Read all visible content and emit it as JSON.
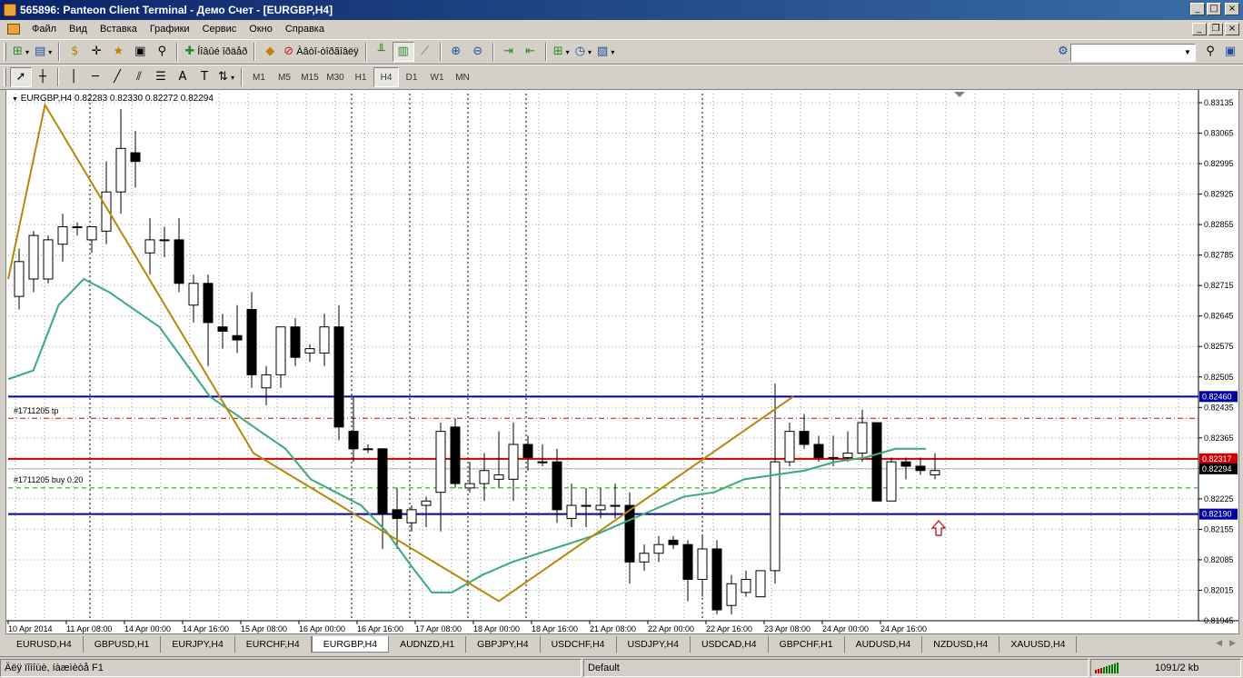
{
  "window": {
    "title": "565896: Panteon Client Terminal - Демо Счет - [EURGBP,H4]"
  },
  "menu": [
    "Файл",
    "Вид",
    "Вставка",
    "Графики",
    "Сервис",
    "Окно",
    "Справка"
  ],
  "toolbar1": {
    "new_order_label": "Íîâûé îðäåð",
    "experts_label": "Àâòî-òîðãîâëÿ"
  },
  "toolbar2": {
    "timeframes": [
      "M1",
      "M5",
      "M15",
      "M30",
      "H1",
      "H4",
      "D1",
      "W1",
      "MN"
    ],
    "active_timeframe": "H4"
  },
  "chart": {
    "symbol_info": "EURGBP,H4  0.82283 0.82330 0.82272 0.82294",
    "tp_label": "#1711205 tp",
    "buy_label": "#1711205 buy 0.20",
    "price_ticks": [
      "0.83135",
      "0.83065",
      "0.82995",
      "0.82925",
      "0.82855",
      "0.82785",
      "0.82715",
      "0.82645",
      "0.82575",
      "0.82505",
      "0.82435",
      "0.82365",
      "0.82295",
      "0.82225",
      "0.82155",
      "0.82085",
      "0.82015",
      "0.81945"
    ],
    "highlighted_prices": [
      {
        "price": "0.82460",
        "color": "#0000a0"
      },
      {
        "price": "0.82317",
        "color": "#d00000"
      },
      {
        "price": "0.82294",
        "color": "#000000"
      },
      {
        "price": "0.82190",
        "color": "#0000a0"
      }
    ],
    "time_ticks": [
      "10 Apr 2014",
      "11 Apr 08:00",
      "14 Apr 00:00",
      "14 Apr 16:00",
      "15 Apr 08:00",
      "16 Apr 00:00",
      "16 Apr 16:00",
      "17 Apr 08:00",
      "18 Apr 00:00",
      "18 Apr 16:00",
      "21 Apr 08:00",
      "22 Apr 00:00",
      "22 Apr 16:00",
      "23 Apr 08:00",
      "24 Apr 00:00",
      "24 Apr 16:00"
    ],
    "colors": {
      "grid": "#9a9a9a",
      "hline_blue": "#0000a0",
      "hline_red": "#d00000",
      "ma": "#3aaa7a",
      "zigzag": "#b8860b",
      "arrow": "#c00000",
      "tp_line": "#d00000",
      "buy_line": "#00a000"
    }
  },
  "chart_data": {
    "type": "candlestick",
    "symbol": "EURGBP",
    "timeframe": "H4",
    "ohlc": [
      [
        0.8269,
        0.828,
        0.8266,
        0.8277
      ],
      [
        0.8273,
        0.8284,
        0.827,
        0.8283
      ],
      [
        0.8273,
        0.8283,
        0.8272,
        0.8282
      ],
      [
        0.8281,
        0.8288,
        0.8277,
        0.8285
      ],
      [
        0.8285,
        0.8286,
        0.8283,
        0.8285
      ],
      [
        0.8282,
        0.8283,
        0.8279,
        0.8285
      ],
      [
        0.8284,
        0.83,
        0.8281,
        0.8293
      ],
      [
        0.8293,
        0.8312,
        0.8288,
        0.8303
      ],
      [
        0.8302,
        0.8307,
        0.8294,
        0.83
      ],
      [
        0.8279,
        0.8287,
        0.8274,
        0.8282
      ],
      [
        0.8282,
        0.8285,
        0.8278,
        0.8282
      ],
      [
        0.8282,
        0.8287,
        0.827,
        0.8272
      ],
      [
        0.8267,
        0.8274,
        0.8263,
        0.8272
      ],
      [
        0.8272,
        0.8274,
        0.8253,
        0.8263
      ],
      [
        0.8262,
        0.8265,
        0.8257,
        0.8261
      ],
      [
        0.826,
        0.8267,
        0.8256,
        0.8259
      ],
      [
        0.8266,
        0.827,
        0.8248,
        0.8251
      ],
      [
        0.8248,
        0.8253,
        0.8244,
        0.8251
      ],
      [
        0.8251,
        0.8262,
        0.8248,
        0.8262
      ],
      [
        0.8262,
        0.8264,
        0.8253,
        0.8255
      ],
      [
        0.8256,
        0.8258,
        0.8254,
        0.8257
      ],
      [
        0.8256,
        0.8265,
        0.8253,
        0.8262
      ],
      [
        0.8262,
        0.8267,
        0.8236,
        0.8239
      ],
      [
        0.8238,
        0.8246,
        0.8231,
        0.8234
      ],
      [
        0.8234,
        0.8235,
        0.8233,
        0.8234
      ],
      [
        0.8234,
        0.8234,
        0.8211,
        0.8219
      ],
      [
        0.822,
        0.8225,
        0.8211,
        0.8218
      ],
      [
        0.8217,
        0.8221,
        0.8215,
        0.822
      ],
      [
        0.8221,
        0.8223,
        0.8216,
        0.8222
      ],
      [
        0.8224,
        0.824,
        0.8215,
        0.8238
      ],
      [
        0.8239,
        0.8241,
        0.8225,
        0.8226
      ],
      [
        0.8225,
        0.8231,
        0.8224,
        0.8226
      ],
      [
        0.8226,
        0.8233,
        0.8222,
        0.8229
      ],
      [
        0.8227,
        0.8238,
        0.8225,
        0.8228
      ],
      [
        0.8227,
        0.824,
        0.8222,
        0.8235
      ],
      [
        0.8235,
        0.8237,
        0.8229,
        0.8232
      ],
      [
        0.8231,
        0.8235,
        0.823,
        0.8231
      ],
      [
        0.8231,
        0.8234,
        0.8217,
        0.822
      ],
      [
        0.8218,
        0.8226,
        0.8216,
        0.8221
      ],
      [
        0.8221,
        0.8225,
        0.8216,
        0.8221
      ],
      [
        0.822,
        0.8225,
        0.8218,
        0.8221
      ],
      [
        0.8221,
        0.8226,
        0.8218,
        0.8221
      ],
      [
        0.8221,
        0.8224,
        0.8203,
        0.8208
      ],
      [
        0.8208,
        0.8212,
        0.8206,
        0.821
      ],
      [
        0.821,
        0.8214,
        0.8208,
        0.8212
      ],
      [
        0.8213,
        0.8214,
        0.8211,
        0.8212
      ],
      [
        0.8212,
        0.8213,
        0.8199,
        0.8204
      ],
      [
        0.8204,
        0.8214,
        0.82,
        0.8211
      ],
      [
        0.8211,
        0.8213,
        0.8196,
        0.8197
      ],
      [
        0.8198,
        0.8205,
        0.8196,
        0.8203
      ],
      [
        0.8201,
        0.8206,
        0.82,
        0.8204
      ],
      [
        0.82,
        0.8206,
        0.8201,
        0.8206
      ],
      [
        0.8206,
        0.8249,
        0.8203,
        0.8231
      ],
      [
        0.8231,
        0.824,
        0.823,
        0.8238
      ],
      [
        0.8238,
        0.8242,
        0.8234,
        0.8235
      ],
      [
        0.8235,
        0.8237,
        0.8231,
        0.8232
      ],
      [
        0.8232,
        0.8237,
        0.823,
        0.8232
      ],
      [
        0.8232,
        0.8238,
        0.8231,
        0.8233
      ],
      [
        0.8233,
        0.8243,
        0.8231,
        0.824
      ],
      [
        0.824,
        0.8239,
        0.8222,
        0.8222
      ],
      [
        0.8222,
        0.8232,
        0.8222,
        0.8231
      ],
      [
        0.8231,
        0.8232,
        0.8227,
        0.823
      ],
      [
        0.823,
        0.8232,
        0.8228,
        0.8229
      ],
      [
        0.8228,
        0.8233,
        0.8227,
        0.8229
      ]
    ],
    "moving_average": [
      [
        0,
        0.825
      ],
      [
        5,
        0.8252
      ],
      [
        10,
        0.8267
      ],
      [
        15,
        0.8273
      ],
      [
        20,
        0.827
      ],
      [
        25,
        0.8266
      ],
      [
        30,
        0.8262
      ],
      [
        35,
        0.8254
      ],
      [
        40,
        0.8246
      ],
      [
        45,
        0.8242
      ],
      [
        50,
        0.8238
      ],
      [
        55,
        0.8234
      ],
      [
        60,
        0.8227
      ],
      [
        65,
        0.8224
      ],
      [
        70,
        0.8221
      ],
      [
        75,
        0.8215
      ],
      [
        80,
        0.8207
      ],
      [
        84,
        0.8201
      ],
      [
        88,
        0.8201
      ],
      [
        94,
        0.8205
      ],
      [
        100,
        0.8208
      ],
      [
        108,
        0.8211
      ],
      [
        116,
        0.8214
      ],
      [
        122,
        0.8217
      ],
      [
        128,
        0.822
      ],
      [
        134,
        0.8223
      ],
      [
        140,
        0.8224
      ],
      [
        146,
        0.8227
      ],
      [
        152,
        0.8228
      ],
      [
        158,
        0.8229
      ],
      [
        164,
        0.8231
      ],
      [
        170,
        0.8232
      ],
      [
        176,
        0.8234
      ],
      [
        182,
        0.8234
      ]
    ],
    "zigzag": [
      [
        0,
        0.8273
      ],
      [
        6,
        0.8313
      ],
      [
        40,
        0.8233
      ],
      [
        80,
        0.8199
      ],
      [
        128,
        0.8246
      ]
    ],
    "hlines": [
      0.8246,
      0.82317,
      0.8219
    ],
    "tp_level": 0.8241,
    "buy_level": 0.8225,
    "ylim": [
      0.81945,
      0.83135
    ]
  },
  "symbol_tabs": [
    "EURUSD,H4",
    "GBPUSD,H1",
    "EURJPY,H4",
    "EURCHF,H4",
    "EURGBP,H4",
    "AUDNZD,H1",
    "GBPJPY,H4",
    "USDCHF,H4",
    "USDJPY,H4",
    "USDCAD,H4",
    "GBPCHF,H1",
    "AUDUSD,H4",
    "NZDUSD,H4",
    "XAUUSD,H4"
  ],
  "active_tab": "EURGBP,H4",
  "status": {
    "help": "Äëÿ ïîìîùè, íàæìèòå F1",
    "profile": "Default",
    "traffic": "1091/2 kb"
  }
}
